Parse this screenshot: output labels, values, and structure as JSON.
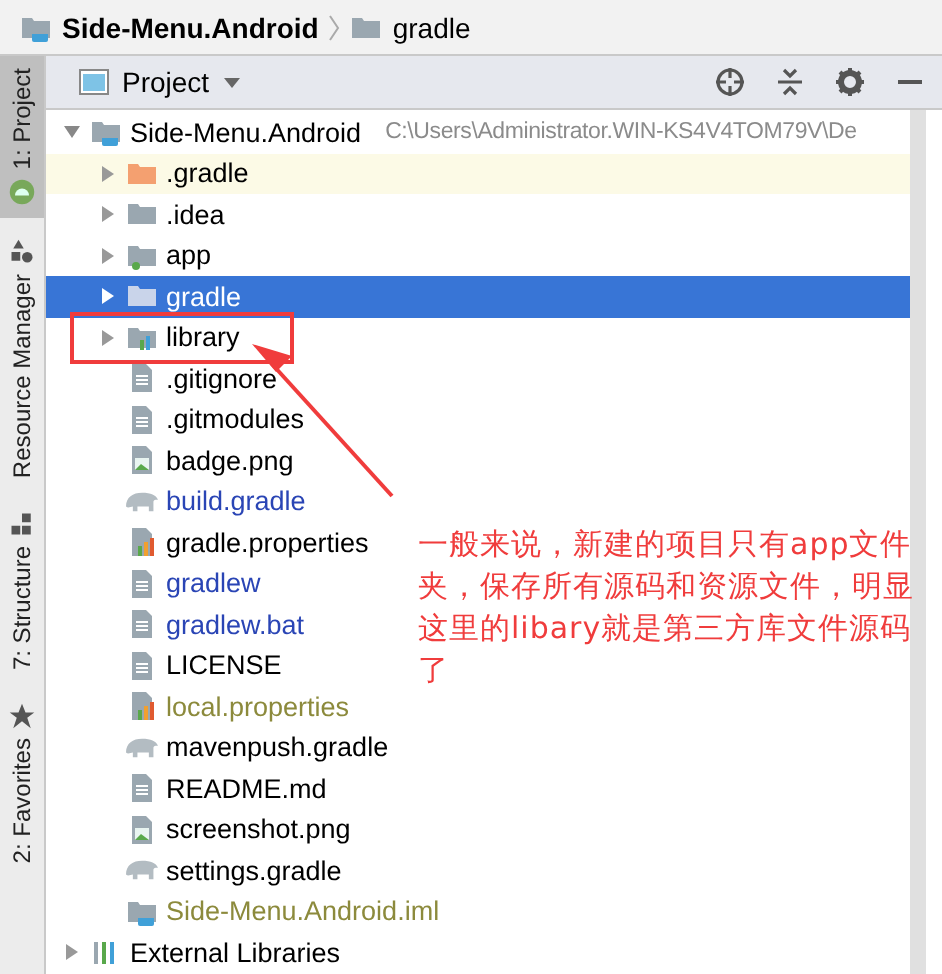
{
  "breadcrumb": [
    {
      "label": "Side-Menu.Android",
      "kind": "module"
    },
    {
      "label": "gradle",
      "kind": "folder"
    }
  ],
  "side_tabs": [
    {
      "label": "1: Project",
      "kind": "android",
      "selected": true
    },
    {
      "label": "Resource Manager",
      "kind": "shapes",
      "selected": false
    },
    {
      "label": "7: Structure",
      "kind": "blocks",
      "selected": false
    },
    {
      "label": "2: Favorites",
      "kind": "star",
      "selected": false
    }
  ],
  "panel": {
    "title": "Project"
  },
  "tree": [
    {
      "label": "Side-Menu.Android",
      "path": "C:\\Users\\Administrator.WIN-KS4V4TOM79V\\De",
      "kind": "module",
      "modified": false,
      "ignored": false,
      "expanded": true,
      "selected": false,
      "highlighted": false,
      "children": [
        {
          "label": ".gradle",
          "kind": "folder-excluded",
          "modified": false,
          "ignored": false,
          "expanded": false,
          "selected": false,
          "highlighted": true
        },
        {
          "label": ".idea",
          "kind": "folder",
          "modified": false,
          "ignored": false,
          "expanded": false,
          "selected": false,
          "highlighted": false
        },
        {
          "label": "app",
          "kind": "folder-app",
          "modified": false,
          "ignored": false,
          "expanded": false,
          "selected": false,
          "highlighted": false
        },
        {
          "label": "gradle",
          "kind": "folder",
          "modified": false,
          "ignored": false,
          "expanded": false,
          "selected": true,
          "highlighted": false
        },
        {
          "label": "library",
          "kind": "folder-library",
          "modified": false,
          "ignored": false,
          "expanded": false,
          "selected": false,
          "highlighted": false
        },
        {
          "label": ".gitignore",
          "kind": "text",
          "modified": false,
          "ignored": false,
          "selected": false,
          "highlighted": false
        },
        {
          "label": ".gitmodules",
          "kind": "text",
          "modified": false,
          "ignored": false,
          "selected": false,
          "highlighted": false
        },
        {
          "label": "badge.png",
          "kind": "image",
          "modified": false,
          "ignored": false,
          "selected": false,
          "highlighted": false
        },
        {
          "label": "build.gradle",
          "kind": "gradle",
          "modified": true,
          "ignored": false,
          "selected": false,
          "highlighted": false
        },
        {
          "label": "gradle.properties",
          "kind": "properties",
          "modified": false,
          "ignored": false,
          "selected": false,
          "highlighted": false
        },
        {
          "label": "gradlew",
          "kind": "text",
          "modified": true,
          "ignored": false,
          "selected": false,
          "highlighted": false
        },
        {
          "label": "gradlew.bat",
          "kind": "text",
          "modified": true,
          "ignored": false,
          "selected": false,
          "highlighted": false
        },
        {
          "label": "LICENSE",
          "kind": "text",
          "modified": false,
          "ignored": false,
          "selected": false,
          "highlighted": false
        },
        {
          "label": "local.properties",
          "kind": "properties",
          "modified": false,
          "ignored": true,
          "selected": false,
          "highlighted": false
        },
        {
          "label": "mavenpush.gradle",
          "kind": "gradle",
          "modified": false,
          "ignored": false,
          "selected": false,
          "highlighted": false
        },
        {
          "label": "README.md",
          "kind": "text",
          "modified": false,
          "ignored": false,
          "selected": false,
          "highlighted": false
        },
        {
          "label": "screenshot.png",
          "kind": "image",
          "modified": false,
          "ignored": false,
          "selected": false,
          "highlighted": false
        },
        {
          "label": "settings.gradle",
          "kind": "gradle",
          "modified": false,
          "ignored": false,
          "selected": false,
          "highlighted": false
        },
        {
          "label": "Side-Menu.Android.iml",
          "kind": "module-file",
          "modified": false,
          "ignored": true,
          "selected": false,
          "highlighted": false
        }
      ]
    },
    {
      "label": "External Libraries",
      "kind": "library",
      "modified": false,
      "ignored": false,
      "expanded": false,
      "selected": false,
      "highlighted": false
    }
  ],
  "annotation": {
    "text": "一般来说，新建的项目只有app文件夹，保存所有源码和资源文件，明显这里的libary就是第三方库文件源码了"
  }
}
